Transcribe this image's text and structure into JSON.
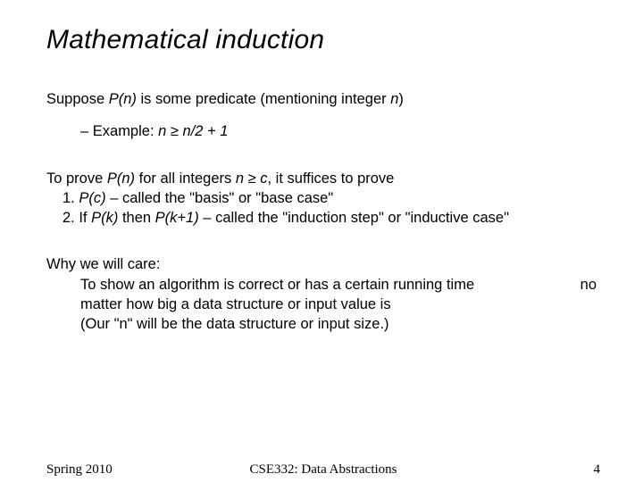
{
  "title": "Mathematical induction",
  "line1_a": "Suppose ",
  "line1_b": "P(n)",
  "line1_c": " is some predicate (mentioning integer ",
  "line1_d": "n",
  "line1_e": ")",
  "example_prefix": "–  Example: ",
  "example_expr": "n ≥ n/2 + 1",
  "prove_a": "To prove ",
  "prove_b": "P(n)",
  "prove_c": " for all integers ",
  "prove_d": "n ≥ c",
  "prove_e": ", it suffices to prove",
  "item1_num": "1.   ",
  "item1_a": "P(c)",
  "item1_b": " – called the \"basis\" or \"base case\"",
  "item2_num": "2.   If ",
  "item2_a": "P(k)",
  "item2_b": " then ",
  "item2_c": "P(k+1)",
  "item2_d": " – called the \"induction step\" or \"inductive case\"",
  "why_heading": "Why we will care:",
  "why_line1": "To show an algorithm is correct or has a certain running time",
  "why_no": "no",
  "why_line2": "matter how big a data structure or input value is",
  "why_line3": "(Our \"n\" will be the data structure or input size.)",
  "footer_left": "Spring 2010",
  "footer_center": "CSE332: Data Abstractions",
  "footer_right": "4"
}
